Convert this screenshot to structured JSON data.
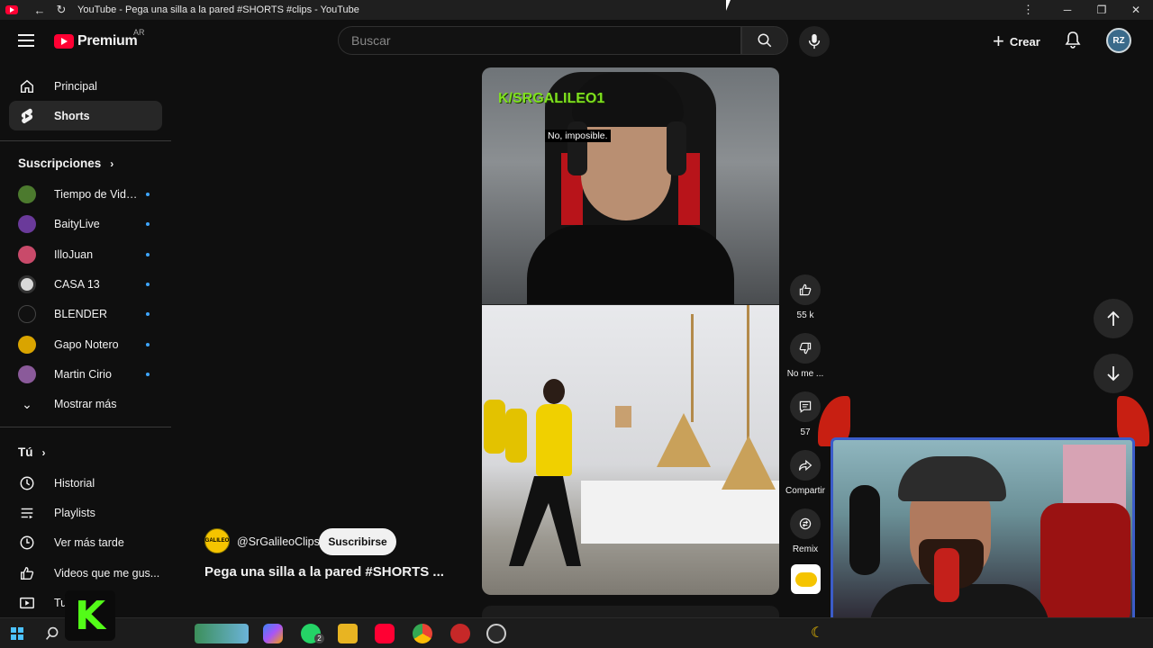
{
  "window": {
    "title": "YouTube - Pega una silla a la pared #SHORTS #clips - YouTube",
    "controls": [
      "─",
      "❐",
      "✕"
    ]
  },
  "header": {
    "logo_text": "Premium",
    "country": "AR",
    "search_placeholder": "Buscar",
    "create_label": "Crear",
    "avatar_initials": "RZ"
  },
  "sidebar": {
    "main": [
      {
        "label": "Principal",
        "icon": "home-icon"
      },
      {
        "label": "Shorts",
        "icon": "shorts-icon",
        "active": true
      }
    ],
    "subscriptions_title": "Suscripciones",
    "subscriptions": [
      {
        "name": "Tiempo de Video...",
        "color": "#4c7a2e"
      },
      {
        "name": "BaityLive",
        "color": "#6a3a9a"
      },
      {
        "name": "IlloJuan",
        "color": "#c94a6a"
      },
      {
        "name": "CASA 13",
        "color": "#d8d8d8"
      },
      {
        "name": "BLENDER",
        "color": "#111111"
      },
      {
        "name": "Gapo Notero",
        "color": "#d9a400"
      },
      {
        "name": "Martin Cirio",
        "color": "#8a5a9a"
      }
    ],
    "show_more": "Mostrar más",
    "you_title": "Tú",
    "you_items": [
      {
        "label": "Historial",
        "icon": "history-icon"
      },
      {
        "label": "Playlists",
        "icon": "playlists-icon"
      },
      {
        "label": "Ver más tarde",
        "icon": "watch-later-icon"
      },
      {
        "label": "Videos que me gus...",
        "icon": "like-icon"
      },
      {
        "label": "Tu",
        "icon": "your-videos-icon"
      }
    ]
  },
  "short": {
    "overlay_channel": "K/SRGALILEO1",
    "caption": "No, imposible.",
    "channel_handle": "@SrGalileoClips",
    "channel_avatar_text": "GALILEO",
    "subscribe_label": "Suscribirse",
    "title": "Pega una silla a la pared #SHORTS  ..."
  },
  "actions": {
    "like_count": "55 k",
    "dislike_label": "No me ...",
    "comments_count": "57",
    "share_label": "Compartir",
    "remix_label": "Remix"
  },
  "taskbar": {
    "whatsapp_badge": "2",
    "kick_letter": "K"
  },
  "colors": {
    "background": "#0f0f0f",
    "brand_red": "#ff0033",
    "kick_green": "#53fc18",
    "accent_blue": "#3ea6ff"
  }
}
